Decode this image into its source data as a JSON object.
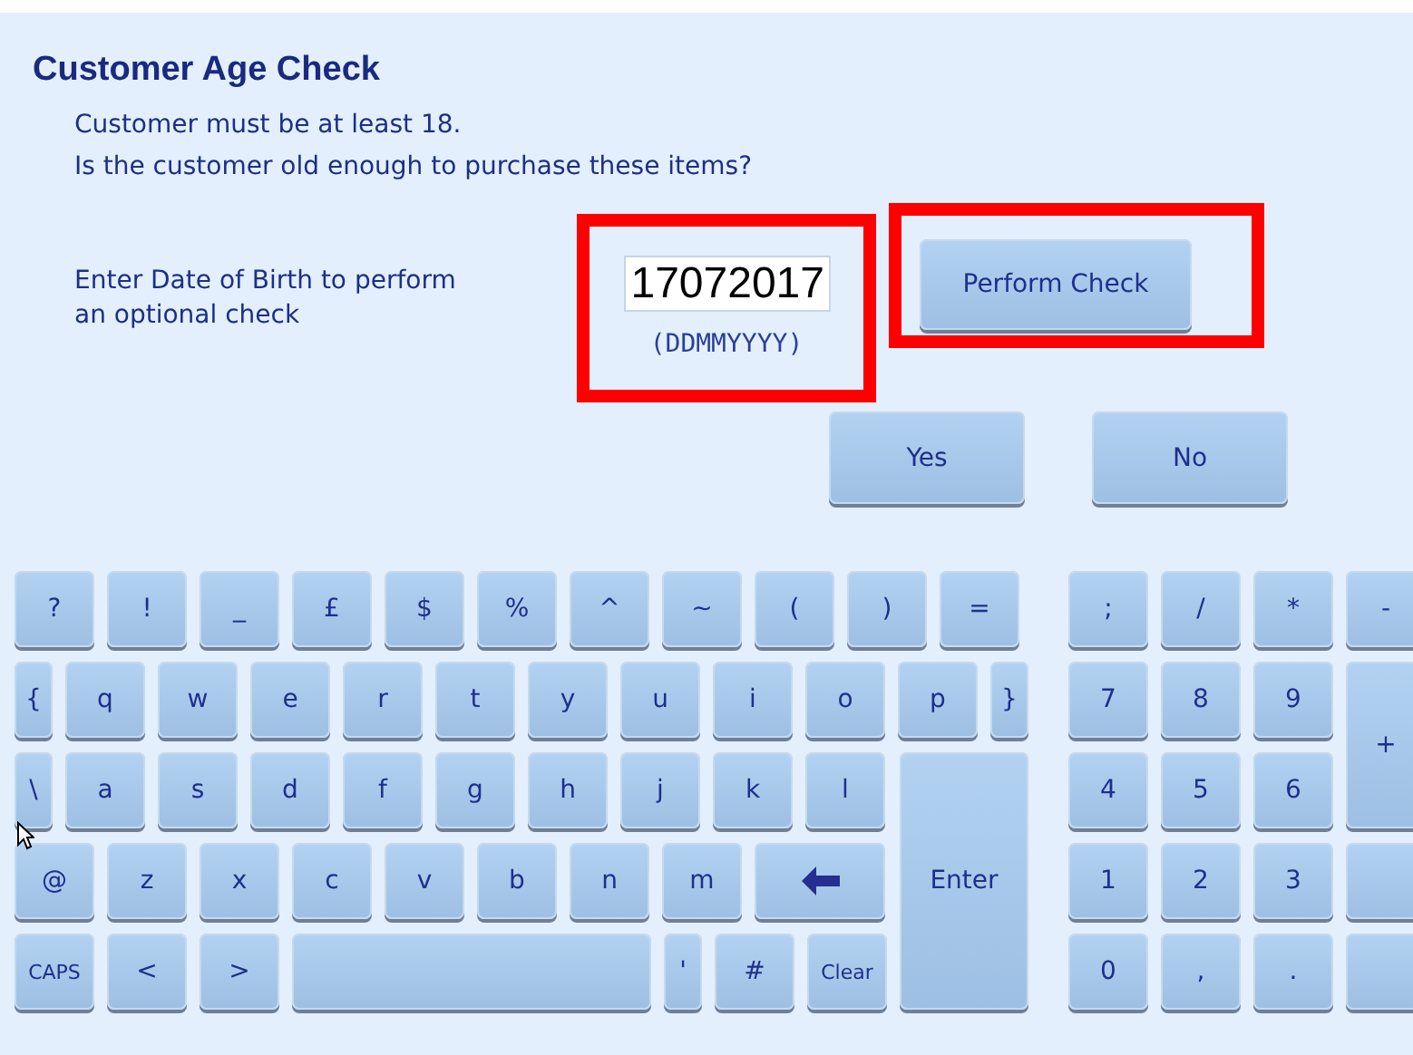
{
  "title": "Customer Age Check",
  "messages": [
    "Customer must be at least 18.",
    "Is the customer old enough to purchase these items?"
  ],
  "dob": {
    "label": "Enter Date of Birth to perform an optional check",
    "value": "17072017",
    "format": "(DDMMYYYY)",
    "highlighted": true
  },
  "perform_button": {
    "label": "Perform Check",
    "highlighted": true
  },
  "answer_buttons": [
    "Yes",
    "No"
  ],
  "keyboard": {
    "symbol_row": [
      {
        "kind": "std",
        "label": "?"
      },
      {
        "kind": "std",
        "label": "!"
      },
      {
        "kind": "std",
        "label": "_"
      },
      {
        "kind": "std",
        "label": "£"
      },
      {
        "kind": "std",
        "label": "$"
      },
      {
        "kind": "std",
        "label": "%"
      },
      {
        "kind": "std",
        "label": "^"
      },
      {
        "kind": "std",
        "label": "~"
      },
      {
        "kind": "std",
        "label": "("
      },
      {
        "kind": "std",
        "label": ")"
      },
      {
        "kind": "std",
        "label": "="
      }
    ],
    "top_row": [
      {
        "kind": "narrow",
        "label": "{"
      },
      {
        "kind": "std",
        "label": "q"
      },
      {
        "kind": "std",
        "label": "w"
      },
      {
        "kind": "std",
        "label": "e"
      },
      {
        "kind": "std",
        "label": "r"
      },
      {
        "kind": "std",
        "label": "t"
      },
      {
        "kind": "std",
        "label": "y"
      },
      {
        "kind": "std",
        "label": "u"
      },
      {
        "kind": "std",
        "label": "i"
      },
      {
        "kind": "std",
        "label": "o"
      },
      {
        "kind": "std",
        "label": "p"
      },
      {
        "kind": "narrow",
        "label": "}"
      }
    ],
    "home_row": [
      {
        "kind": "narrow",
        "label": "\\"
      },
      {
        "kind": "std",
        "label": "a"
      },
      {
        "kind": "std",
        "label": "s"
      },
      {
        "kind": "std",
        "label": "d"
      },
      {
        "kind": "std",
        "label": "f"
      },
      {
        "kind": "std",
        "label": "g"
      },
      {
        "kind": "std",
        "label": "h"
      },
      {
        "kind": "std",
        "label": "j"
      },
      {
        "kind": "std",
        "label": "k"
      },
      {
        "kind": "std",
        "label": "l"
      }
    ],
    "lower_row": [
      {
        "kind": "std",
        "label": "@"
      },
      {
        "kind": "std",
        "label": "z"
      },
      {
        "kind": "std",
        "label": "x"
      },
      {
        "kind": "std",
        "label": "c"
      },
      {
        "kind": "std",
        "label": "v"
      },
      {
        "kind": "std",
        "label": "b"
      },
      {
        "kind": "std",
        "label": "n"
      },
      {
        "kind": "std",
        "label": "m"
      },
      {
        "kind": "backspace"
      }
    ],
    "bottom_row": [
      {
        "kind": "small",
        "label": "CAPS"
      },
      {
        "kind": "std",
        "label": "<"
      },
      {
        "kind": "std",
        "label": ">"
      },
      {
        "kind": "space"
      },
      {
        "kind": "narrow",
        "label": "'"
      },
      {
        "kind": "std",
        "label": "#"
      },
      {
        "kind": "small",
        "label": "Clear"
      }
    ],
    "enter_key": "Enter"
  },
  "numpad": [
    {
      "kind": "std",
      "label": ";"
    },
    {
      "kind": "std",
      "label": "/"
    },
    {
      "kind": "std",
      "label": "*"
    },
    {
      "kind": "std",
      "label": "-"
    },
    {
      "kind": "std",
      "label": "7"
    },
    {
      "kind": "std",
      "label": "8"
    },
    {
      "kind": "std",
      "label": "9"
    },
    {
      "kind": "tall",
      "label": "+"
    },
    {
      "kind": "std",
      "label": "4"
    },
    {
      "kind": "std",
      "label": "5"
    },
    {
      "kind": "std",
      "label": "6"
    },
    {
      "kind": "std",
      "label": "1"
    },
    {
      "kind": "std",
      "label": "2"
    },
    {
      "kind": "std",
      "label": "3"
    },
    {
      "kind": "blank"
    },
    {
      "kind": "std",
      "label": "0"
    },
    {
      "kind": "std",
      "label": ","
    },
    {
      "kind": "std",
      "label": "."
    },
    {
      "kind": "blank"
    }
  ]
}
